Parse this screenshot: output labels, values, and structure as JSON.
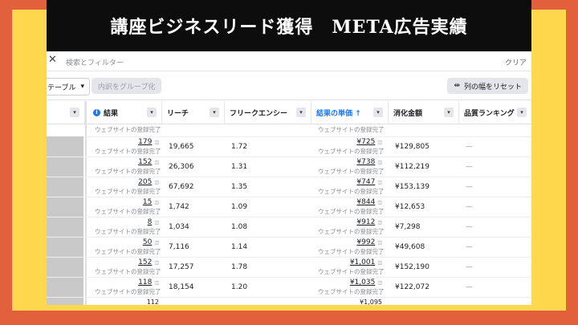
{
  "title": "講座ビジネスリード獲得　META広告実績",
  "search": {
    "placeholder": "検索とフィルター",
    "clear_label": "クリア"
  },
  "toolbar": {
    "table_label": "テーブル",
    "group_label": "内訳をグループ化",
    "reset_label": "列の幅をリセット"
  },
  "columns": {
    "results": "結果",
    "reach": "リーチ",
    "frequency": "フリークエンシー",
    "cost_per_result": "結果の単価 ↑",
    "amount_spent": "消化金額",
    "quality_ranking": "品質ランキング"
  },
  "result_type": "ウェブサイトの登録完了",
  "rows": [
    {
      "results": "179",
      "reach": "19,665",
      "frequency": "1.72",
      "cost": "¥725",
      "spent": "¥129,805",
      "quality": "—"
    },
    {
      "results": "152",
      "reach": "26,306",
      "frequency": "1.31",
      "cost": "¥738",
      "spent": "¥112,219",
      "quality": "—"
    },
    {
      "results": "205",
      "reach": "67,692",
      "frequency": "1.35",
      "cost": "¥747",
      "spent": "¥153,139",
      "quality": "—"
    },
    {
      "results": "15",
      "reach": "1,742",
      "frequency": "1.09",
      "cost": "¥844",
      "spent": "¥12,653",
      "quality": "—"
    },
    {
      "results": "8",
      "reach": "1,034",
      "frequency": "1.08",
      "cost": "¥912",
      "spent": "¥7,298",
      "quality": "—"
    },
    {
      "results": "50",
      "reach": "7,116",
      "frequency": "1.14",
      "cost": "¥992",
      "spent": "¥49,608",
      "quality": "—"
    },
    {
      "results": "152",
      "reach": "17,257",
      "frequency": "1.78",
      "cost": "¥1,001",
      "spent": "¥152,190",
      "quality": "—"
    },
    {
      "results": "118",
      "reach": "18,154",
      "frequency": "1.20",
      "cost": "¥1,035",
      "spent": "¥122,072",
      "quality": "—"
    }
  ],
  "partial_bottom": {
    "results": "112",
    "cost": "¥1,095"
  }
}
